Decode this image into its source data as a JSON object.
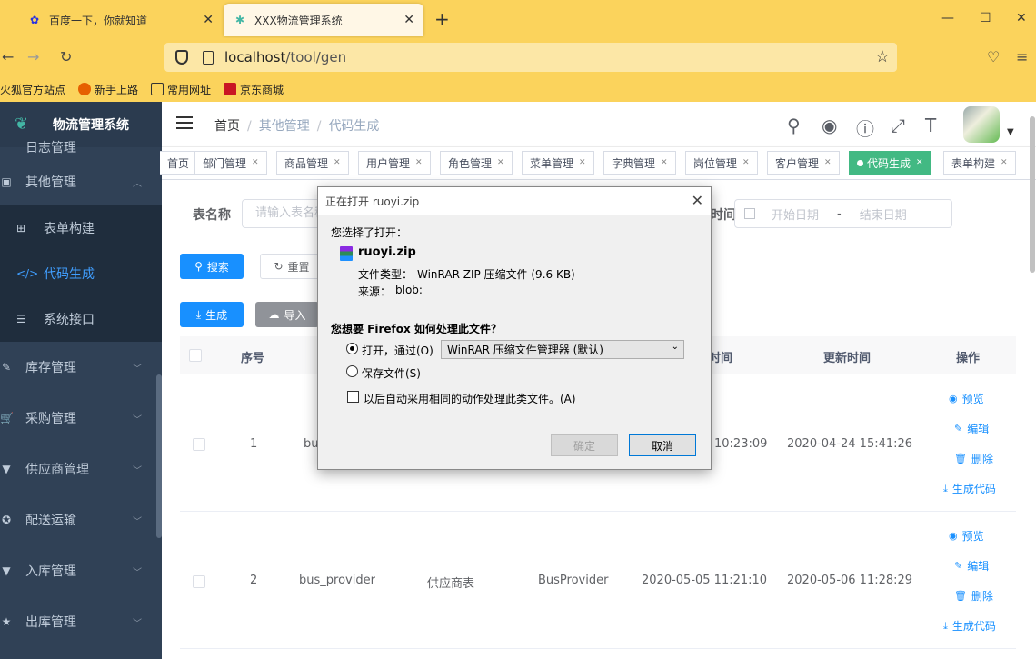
{
  "browser": {
    "tabs": [
      {
        "title": "百度一下，你就知道"
      },
      {
        "title": "XXX物流管理系统"
      }
    ],
    "url_host": "localhost",
    "url_path": "/tool/gen",
    "bookmarks": [
      "火狐官方站点",
      "新手上路",
      "常用网址",
      "京东商城"
    ]
  },
  "app": {
    "title": "物流管理系统",
    "sidebar": {
      "partial_item": "日志管理",
      "group": "其他管理",
      "subitems": [
        "表单构建",
        "代码生成",
        "系统接口"
      ],
      "items": [
        "库存管理",
        "采购管理",
        "供应商管理",
        "配送运输",
        "入库管理",
        "出库管理"
      ]
    },
    "breadcrumb": [
      "首页",
      "其他管理",
      "代码生成"
    ],
    "tags": [
      "首页",
      "部门管理",
      "商品管理",
      "用户管理",
      "角色管理",
      "菜单管理",
      "字典管理",
      "岗位管理",
      "客户管理",
      "代码生成",
      "表单构建"
    ]
  },
  "filter": {
    "table_name_label": "表名称",
    "table_name_placeholder": "请输入表名称",
    "time_label": "时间",
    "start_date": "开始日期",
    "end_date": "结束日期",
    "date_sep": "-"
  },
  "buttons": {
    "search": "搜索",
    "reset": "重置",
    "generate": "生成",
    "import": "导入"
  },
  "table": {
    "headers": {
      "no": "序号",
      "create_time": "时间",
      "update_time": "更新时间",
      "ops": "操作"
    },
    "rows": [
      {
        "no": "1",
        "name": "bu",
        "comment": "",
        "entity": "",
        "create_time": "10:23:09",
        "update_time": "2020-04-24 15:41:26"
      },
      {
        "no": "2",
        "name": "bus_provider",
        "comment": "供应商表",
        "entity": "BusProvider",
        "create_time": "2020-05-05 11:21:10",
        "update_time": "2020-05-06 11:28:29"
      }
    ],
    "ops": [
      "预览",
      "编辑",
      "删除",
      "生成代码"
    ]
  },
  "dialog": {
    "title": "正在打开 ruoyi.zip",
    "you_chose": "您选择了打开：",
    "filename": "ruoyi.zip",
    "filetype_label": "文件类型：",
    "filetype_value": "WinRAR ZIP 压缩文件 (9.6 KB)",
    "source_label": "来源：",
    "source_value": "blob:",
    "question": "您想要 Firefox 如何处理此文件？",
    "open_with": "打开，通过(O)",
    "app_choice": "WinRAR 压缩文件管理器 (默认)",
    "save_file": "保存文件(S)",
    "auto_option": "以后自动采用相同的动作处理此类文件。(A)",
    "ok": "确定",
    "cancel": "取消"
  }
}
